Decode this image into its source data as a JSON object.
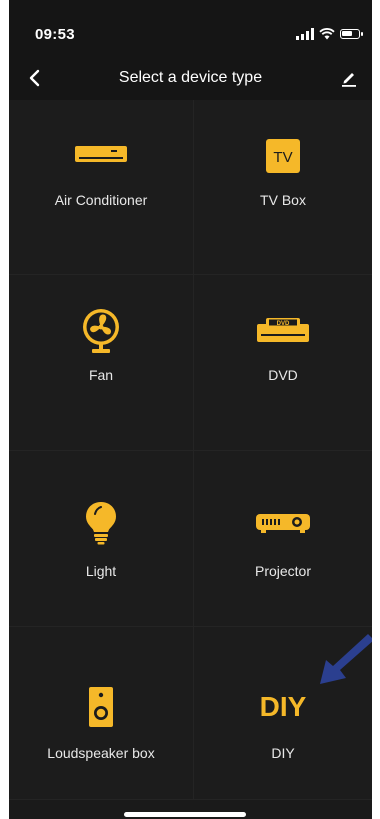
{
  "status_bar": {
    "time": "09:53"
  },
  "nav": {
    "title": "Select a device type"
  },
  "devices": [
    {
      "label": "Air Conditioner",
      "icon": "air-conditioner-icon"
    },
    {
      "label": "TV Box",
      "icon": "tv-box-icon",
      "icon_text": "TV"
    },
    {
      "label": "Fan",
      "icon": "fan-icon"
    },
    {
      "label": "DVD",
      "icon": "dvd-icon",
      "icon_text": "DVD"
    },
    {
      "label": "Light",
      "icon": "light-bulb-icon"
    },
    {
      "label": "Projector",
      "icon": "projector-icon"
    },
    {
      "label": "Loudspeaker box",
      "icon": "loudspeaker-icon"
    },
    {
      "label": "DIY",
      "icon": "diy-icon",
      "icon_text": "DIY"
    }
  ],
  "colors": {
    "accent": "#f5b829",
    "background": "#1a1a1a",
    "annotation_arrow": "#2b3f8f"
  }
}
